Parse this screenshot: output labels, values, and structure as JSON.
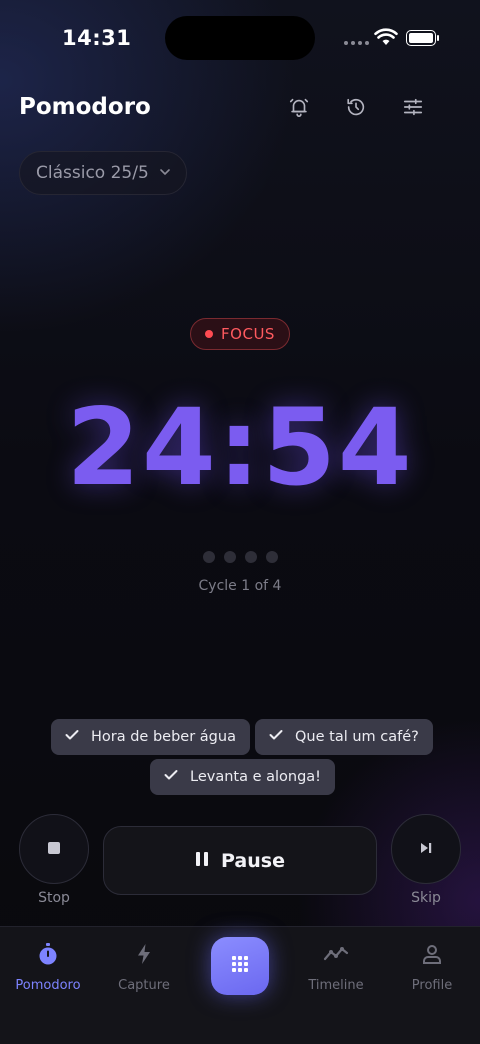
{
  "status_bar": {
    "time": "14:31"
  },
  "header": {
    "title": "Pomodoro",
    "icons": [
      "bell-icon",
      "history-icon",
      "sliders-icon"
    ]
  },
  "preset": {
    "label": "Clássico 25/5"
  },
  "session": {
    "mode": "FOCUS",
    "mode_color": "#ff4b52",
    "timer": "24:54",
    "cycle_text": "Cycle 1 of 4",
    "cycles_total": 4,
    "cycles_completed": 0
  },
  "reminders": [
    {
      "label": "Hora de beber água"
    },
    {
      "label": "Que tal um café?"
    },
    {
      "label": "Levanta e alonga!"
    }
  ],
  "controls": {
    "stop_label": "Stop",
    "pause_label": "Pause",
    "skip_label": "Skip"
  },
  "nav": {
    "items": [
      {
        "label": "Pomodoro",
        "icon": "stopwatch-icon",
        "active": true
      },
      {
        "label": "Capture",
        "icon": "bolt-icon",
        "active": false
      },
      {
        "label": "",
        "icon": "grid-icon",
        "active": false
      },
      {
        "label": "Timeline",
        "icon": "trend-icon",
        "active": false
      },
      {
        "label": "Profile",
        "icon": "user-icon",
        "active": false
      }
    ]
  },
  "colors": {
    "accent": "#7b5cf0",
    "nav_active": "#7d83ff",
    "focus": "#ff4b52"
  }
}
